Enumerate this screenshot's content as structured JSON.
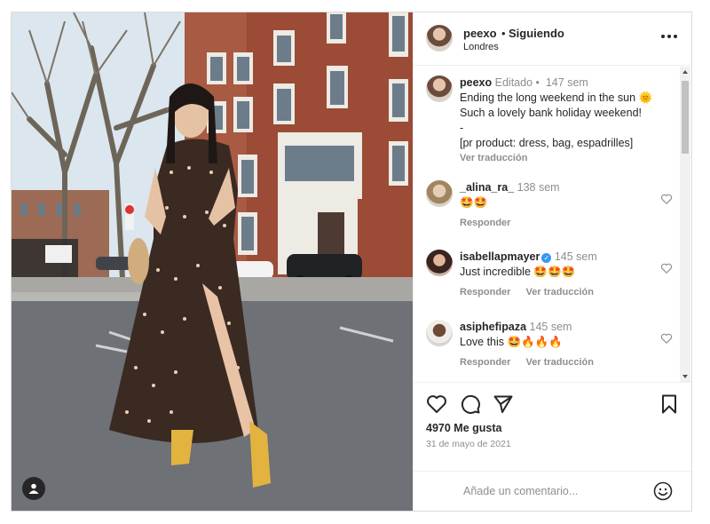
{
  "header": {
    "username": "peexo",
    "dot": "•",
    "follow_status": "Siguiendo",
    "location": "Londres"
  },
  "caption": {
    "username": "peexo",
    "edited": "Editado",
    "dot": "•",
    "age": "147 sem",
    "lines": [
      "Ending the long weekend in the sun 🌞",
      "Such a lovely bank holiday weekend!",
      "-",
      "[pr product: dress, bag, espadrilles]"
    ],
    "translate": "Ver traducción"
  },
  "comments": [
    {
      "username": "_alina_ra_",
      "age": "138 sem",
      "verified": false,
      "text": "🤩🤩",
      "reply": "Responder",
      "translate": ""
    },
    {
      "username": "isabellapmayer",
      "age": "145 sem",
      "verified": true,
      "text": "Just incredible 🤩🤩🤩",
      "reply": "Responder",
      "translate": "Ver traducción"
    },
    {
      "username": "asiphefipaza",
      "age": "145 sem",
      "verified": false,
      "text": "Love this 🤩🔥🔥🔥",
      "reply": "Responder",
      "translate": "Ver traducción"
    }
  ],
  "stats": {
    "likes": "4970 Me gusta",
    "date": "31 de mayo de 2021"
  },
  "add_comment": {
    "placeholder": "Añade un comentario..."
  },
  "icons": {
    "like": "heart-icon",
    "comment": "comment-icon",
    "share": "paper-plane-icon",
    "save": "bookmark-icon",
    "more": "more-horizontal-icon",
    "emoji": "emoji-icon",
    "user_tag": "user-tag-icon"
  },
  "colors": {
    "verified": "#3897f0",
    "muted_text": "#8e8e8e",
    "border": "#dbdbdb"
  }
}
